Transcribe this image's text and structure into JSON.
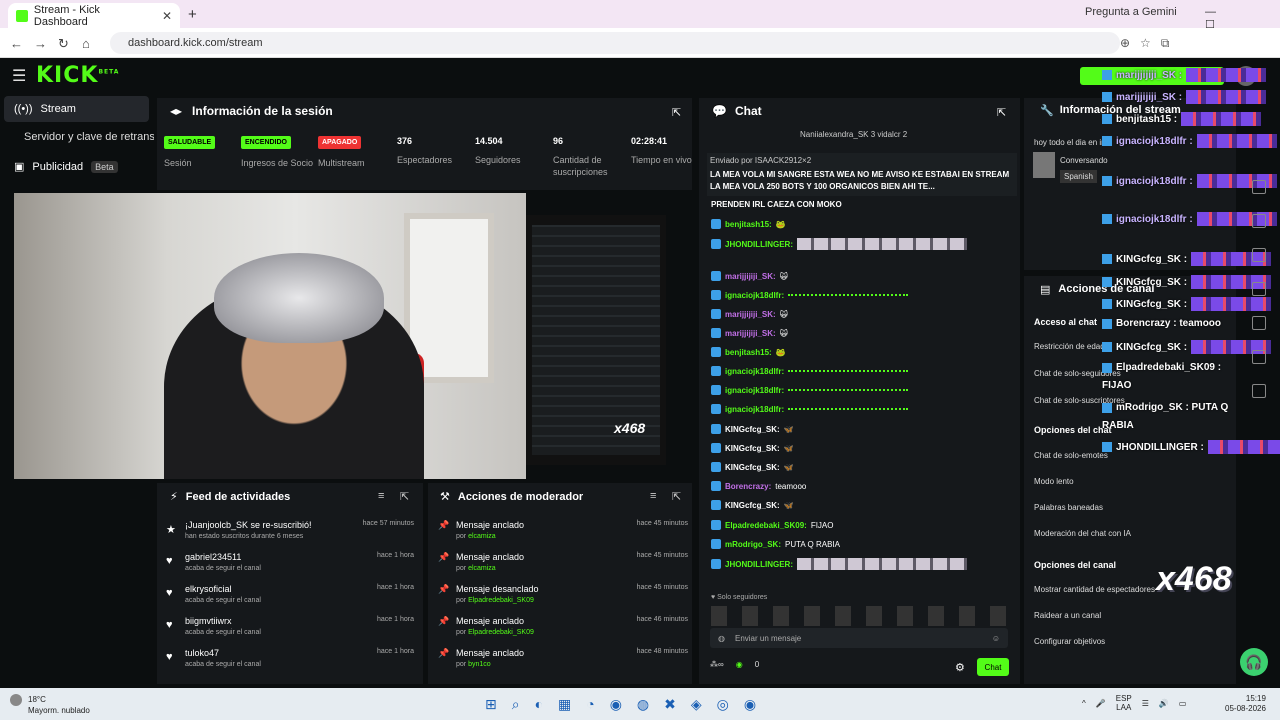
{
  "browser": {
    "tab_title": "Stream - Kick Dashboard",
    "new_tab": "+",
    "url": "dashboard.kick.com/stream",
    "gemini": "Pregunta a Gemini",
    "window_controls": "— ☐ ✕"
  },
  "app": {
    "logo": "KICK",
    "logo_sup": "BETA"
  },
  "sidebar": {
    "stream": "Stream",
    "servidor": "Servidor y clave de retransmisión",
    "publicidad": "Publicidad",
    "beta": "Beta"
  },
  "session": {
    "title": "Información de la sesión",
    "stats": [
      {
        "badge": "SALUDABLE",
        "label": "Sesión"
      },
      {
        "badge": "ENCENDIDO",
        "label": "Ingresos de Socio"
      },
      {
        "badge": "APAGADO",
        "label": "Multistream"
      },
      {
        "value": "376",
        "label": "Espectadores"
      },
      {
        "value": "14.504",
        "label": "Seguidores"
      },
      {
        "value": "96",
        "label": "Cantidad de suscripciones"
      },
      {
        "value": "02:28:41",
        "label": "Tiempo en vivo"
      }
    ]
  },
  "webcam": {
    "overlay_badge": "x468"
  },
  "feed": {
    "title": "Feed de actividades",
    "items": [
      {
        "name": "¡Juanjoolcb_SK se re-suscribió!",
        "sub": "han estado suscritos durante 6 meses",
        "time": "hace 57 minutos"
      },
      {
        "name": "gabriel234511",
        "sub": "acaba de seguir el canal",
        "time": "hace 1 hora"
      },
      {
        "name": "elkrysoficial",
        "sub": "acaba de seguir el canal",
        "time": "hace 1 hora"
      },
      {
        "name": "biigmvtiiwrx",
        "sub": "acaba de seguir el canal",
        "time": "hace 1 hora"
      },
      {
        "name": "tuloko47",
        "sub": "acaba de seguir el canal",
        "time": "hace 1 hora"
      }
    ]
  },
  "mod": {
    "title": "Acciones de moderador",
    "items": [
      {
        "action": "Mensaje anclado",
        "by": "elcamiza",
        "time": "hace 45 minutos"
      },
      {
        "action": "Mensaje anclado",
        "by": "elcamiza",
        "time": "hace 45 minutos"
      },
      {
        "action": "Mensaje desanclado",
        "by": "Elpadredebaki_SK09",
        "time": "hace 45 minutos"
      },
      {
        "action": "Mensaje anclado",
        "by": "Elpadredebaki_SK09",
        "time": "hace 46 minutos"
      },
      {
        "action": "Mensaje anclado",
        "by": "byn1co",
        "time": "hace 48 minutos"
      }
    ],
    "by_prefix": "por"
  },
  "chat": {
    "title": "Chat",
    "top_users": "Naniialexandra_SK 3   vidalcr 2",
    "pinned_by": "Enviado por ISAACK2912×2",
    "pinned_msg": "LA MEA VOLA MI SANGRE ESTA WEA NO ME AVISO KE ESTABAI EN STREAM LA MEA VOLA 250 BOTS Y 100 ORGANICOS BIEN AHI TE...",
    "first_line": "PRENDEN IRL CAEZA CON MOKO",
    "messages": [
      {
        "user": "benjitash15:",
        "color": "#53fc18",
        "kind": "text",
        "text": "🐸"
      },
      {
        "user": "JHONDILLINGER:",
        "color": "#53fc18",
        "kind": "emotes"
      },
      {
        "user": "marijjijiji_SK:",
        "color": "#c270e8",
        "kind": "text",
        "text": "🙀"
      },
      {
        "user": "ignaciojk18dlfr:",
        "color": "#53fc18",
        "kind": "dots"
      },
      {
        "user": "marijjijiji_SK:",
        "color": "#c270e8",
        "kind": "text",
        "text": "🙀"
      },
      {
        "user": "marijjijiji_SK:",
        "color": "#c270e8",
        "kind": "text",
        "text": "🙀"
      },
      {
        "user": "benjitash15:",
        "color": "#53fc18",
        "kind": "text",
        "text": "🐸"
      },
      {
        "user": "ignaciojk18dlfr:",
        "color": "#53fc18",
        "kind": "dots"
      },
      {
        "user": "ignaciojk18dlfr:",
        "color": "#53fc18",
        "kind": "dots"
      },
      {
        "user": "ignaciojk18dlfr:",
        "color": "#53fc18",
        "kind": "dots"
      },
      {
        "user": "KINGcfcg_SK:",
        "color": "#fff",
        "kind": "text",
        "text": "🦋"
      },
      {
        "user": "KINGcfcg_SK:",
        "color": "#fff",
        "kind": "text",
        "text": "🦋"
      },
      {
        "user": "KINGcfcg_SK:",
        "color": "#fff",
        "kind": "text",
        "text": "🦋"
      },
      {
        "user": "Borencrazy:",
        "color": "#c270e8",
        "kind": "text",
        "text": "teamooo"
      },
      {
        "user": "KINGcfcg_SK:",
        "color": "#fff",
        "kind": "text",
        "text": "🦋"
      },
      {
        "user": "Elpadredebaki_SK09:",
        "color": "#53fc18",
        "kind": "text",
        "text": "FIJAO"
      },
      {
        "user": "mRodrigo_SK:",
        "color": "#53fc18",
        "kind": "text",
        "text": "PUTA Q RABIA"
      },
      {
        "user": "JHONDILLINGER:",
        "color": "#53fc18",
        "kind": "emotes"
      }
    ],
    "solo": "♥ Solo seguidores",
    "input_placeholder": "Enviar un mensaje",
    "count": "0",
    "send": "Chat"
  },
  "right": {
    "info_title": "Información del stream",
    "stream_title": "hoy todo el dia en irl",
    "category": "Conversando",
    "language": "Spanish",
    "acciones_title": "Acciones de canal",
    "acceso": "Acceso al chat",
    "items1": [
      "Restricción de edad",
      "Chat de solo-seguidores",
      "Chat de solo-suscriptores"
    ],
    "opciones_chat": "Opciones del chat",
    "items2": [
      "Chat de solo-emotes",
      "Modo lento",
      "Palabras baneadas",
      "Moderación del chat con IA"
    ],
    "opciones_canal": "Opciones del canal",
    "items3": [
      "Mostrar cantidad de espectadores",
      "Raidear a un canal",
      "Configurar objetivos"
    ]
  },
  "overlay": {
    "lines": [
      {
        "user": "marijjijiji_SK :",
        "kind": "emote"
      },
      {
        "user": "marijjijiji_SK :",
        "kind": "emote"
      },
      {
        "user": "benjitash15 :",
        "kind": "emote"
      },
      {
        "user": "ignaciojk18dlfr :",
        "kind": "emote"
      },
      {
        "user": "ignaciojk18dlfr :",
        "kind": "emote"
      },
      {
        "user": "ignaciojk18dlfr :",
        "kind": "emote"
      },
      {
        "user": "KINGcfcg_SK :",
        "kind": "emote"
      },
      {
        "user": "KINGcfcg_SK :",
        "kind": "emote"
      },
      {
        "user": "KINGcfcg_SK :",
        "kind": "emote"
      },
      {
        "user": "Borencrazy : teamooo",
        "kind": "text"
      },
      {
        "user": "KINGcfcg_SK :",
        "kind": "emote"
      },
      {
        "user": "Elpadredebaki_SK09 :",
        "kind": "text"
      },
      {
        "user": "FIJAO",
        "kind": "text"
      },
      {
        "user": "mRodrigo_SK : PUTA Q",
        "kind": "text"
      },
      {
        "user": "RABIA",
        "kind": "text"
      },
      {
        "user": "JHONDILLINGER :",
        "kind": "emote"
      }
    ],
    "badge": "x468"
  },
  "taskbar": {
    "temp": "18°C",
    "weather": "Mayorm. nublado",
    "lang1": "ESP",
    "lang2": "LAA",
    "time": "15:19",
    "date": "05-08-2026"
  }
}
